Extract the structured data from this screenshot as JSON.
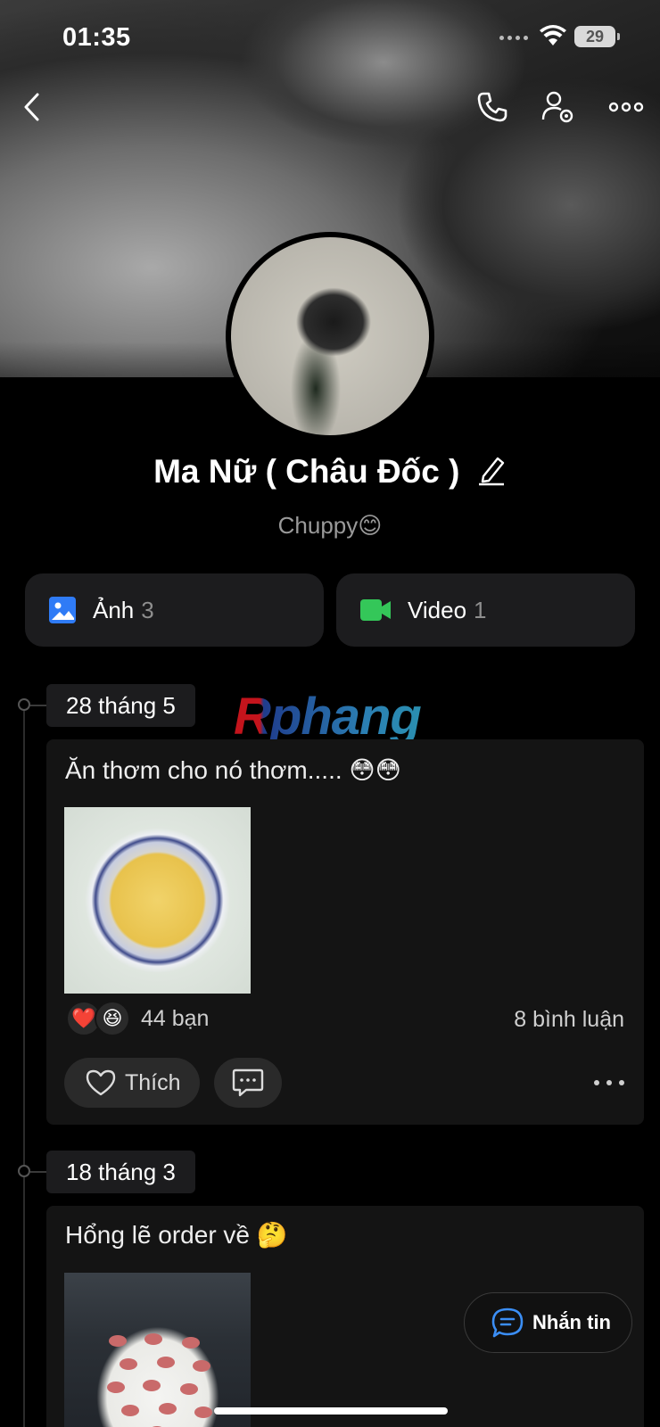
{
  "status_bar": {
    "time": "01:35",
    "battery": "29"
  },
  "profile": {
    "name": "Ma Nữ ( Châu Đốc )",
    "bio": "Chuppy😊"
  },
  "media": [
    {
      "label": "Ảnh",
      "count": "3",
      "icon": "image-icon",
      "color": "#2f7bf6"
    },
    {
      "label": "Video",
      "count": "1",
      "icon": "video-icon",
      "color": "#34c759"
    }
  ],
  "watermark": "Rphang",
  "posts": [
    {
      "date": "28 tháng 5",
      "text": "Ăn thơm cho nó thơm..... 😳😳",
      "image": "pineapple-bowl",
      "reactions": [
        "❤️",
        "😆"
      ],
      "reaction_count": "44 bạn",
      "comments": "8 bình luận",
      "like_label": "Thích"
    },
    {
      "date": "18 tháng 3",
      "text": "Hổng lẽ order về 🤔",
      "image": "printed-tshirt"
    }
  ],
  "message_button": {
    "label": "Nhắn tin"
  },
  "colors": {
    "background": "#000000",
    "card": "#1c1c1e",
    "accent_blue": "#2f7bf6",
    "accent_green": "#34c759"
  }
}
